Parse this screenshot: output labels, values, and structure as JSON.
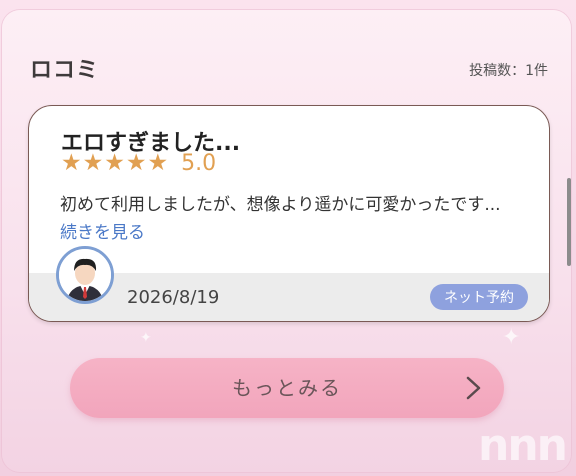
{
  "section": {
    "title": "ロコミ",
    "post_count": "投稿数：1件"
  },
  "review": {
    "title": "エロすぎました...",
    "rating": 5,
    "score_label": "5.0",
    "stars": [
      "★",
      "★",
      "★",
      "★",
      "★"
    ],
    "body": "初めて利用しましたが、想像より遥かに可愛かったです...",
    "more_link": "続きを見る",
    "date": "2026/8/19",
    "badge": "ネット予約"
  },
  "more_button": {
    "label": "もっとみる",
    "icon": "chevron-right-icon"
  },
  "watermark": "nnn",
  "colors": {
    "star": "#e1a052",
    "link": "#4a78c7",
    "badge": "#8ea1de",
    "button": "#f2a5bc",
    "avatar_border": "#7e9fd3"
  }
}
